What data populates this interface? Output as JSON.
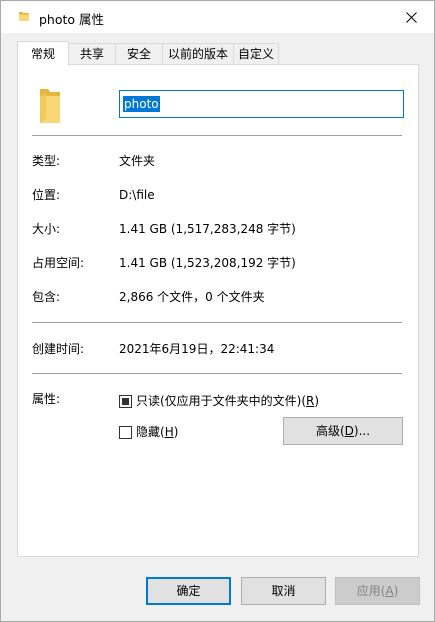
{
  "window": {
    "title": "photo 属性",
    "close_glyph": "✕"
  },
  "tabs": [
    {
      "label": "常规",
      "active": true
    },
    {
      "label": "共享"
    },
    {
      "label": "安全"
    },
    {
      "label": "以前的版本"
    },
    {
      "label": "自定义"
    }
  ],
  "general": {
    "name_value": "photo",
    "type_label": "类型:",
    "type_value": "文件夹",
    "location_label": "位置:",
    "location_value": "D:\\file",
    "size_label": "大小:",
    "size_value": "1.41 GB (1,517,283,248 字节)",
    "size_on_disk_label": "占用空间:",
    "size_on_disk_value": "1.41 GB (1,523,208,192 字节)",
    "contains_label": "包含:",
    "contains_value": "2,866 个文件，0 个文件夹",
    "created_label": "创建时间:",
    "created_value": "2021年6月19日，22:41:34",
    "attributes_label": "属性:",
    "readonly_text": "只读(仅应用于文件夹中的文件)(",
    "readonly_key": "R",
    "readonly_end": ")",
    "hidden_text": "隐藏(",
    "hidden_key": "H",
    "hidden_end": ")",
    "advanced_text": "高级(",
    "advanced_key": "D",
    "advanced_end": ")..."
  },
  "footer": {
    "ok_label": "确定",
    "cancel_label": "取消",
    "apply_text": "应用(",
    "apply_key": "A",
    "apply_end": ")"
  },
  "colors": {
    "accent": "#0078d7",
    "folder_yellow": "#f8d775",
    "folder_dark": "#e6b740"
  },
  "icons": {
    "title": "folder-icon",
    "big": "folder-icon",
    "close": "close-icon"
  }
}
